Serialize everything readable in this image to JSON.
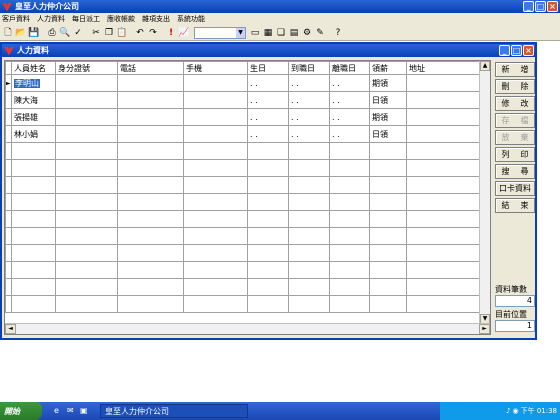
{
  "app": {
    "title": "皇至人力仲介公司"
  },
  "menu": [
    "客戶資料",
    "人力資料",
    "每日派工",
    "應收帳款",
    "雜項支出",
    "系統功能"
  ],
  "toolbar_icons": [
    "new-icon",
    "open-icon",
    "save-icon",
    "print-icon",
    "preview-icon",
    "spell-icon",
    "cut-icon",
    "copy-icon",
    "paste-icon",
    "undo-icon",
    "redo-icon",
    "alert-icon",
    "chart-icon"
  ],
  "child": {
    "title": "人力資料"
  },
  "grid": {
    "columns": [
      "人員姓名",
      "身分證號",
      "電話",
      "手機",
      "生日",
      "到職日",
      "離職日",
      "領薪",
      "地址"
    ],
    "rows": [
      [
        "李明山",
        "",
        "",
        "",
        "  .  .",
        "  .  .",
        "  .  .",
        "期領",
        ""
      ],
      [
        "陳大海",
        "",
        "",
        "",
        "  .  .",
        "  .  .",
        "  .  .",
        "日領",
        ""
      ],
      [
        "張揚雄",
        "",
        "",
        "",
        "  .  .",
        "  .  .",
        "  .  .",
        "期領",
        ""
      ],
      [
        "林小娟",
        "",
        "",
        "",
        "  .  .",
        "  .  .",
        "  .  .",
        "日領",
        ""
      ]
    ],
    "empty_rows": 10
  },
  "buttons": {
    "add": [
      "新",
      "增"
    ],
    "delete": [
      "刪",
      "除"
    ],
    "edit": [
      "修",
      "改"
    ],
    "save": [
      "存",
      "檔"
    ],
    "abort": [
      "放",
      "棄"
    ],
    "print": [
      "列",
      "印"
    ],
    "search": [
      "搜",
      "尋"
    ],
    "card": "口卡資料",
    "close": [
      "結",
      "束"
    ]
  },
  "info": {
    "count_label": "資料筆數",
    "count": "4",
    "pos_label": "目前位置",
    "pos": "1"
  },
  "taskbar": {
    "start": "開始",
    "task": "皇至人力仲介公司",
    "clock": "下午 01:38"
  }
}
